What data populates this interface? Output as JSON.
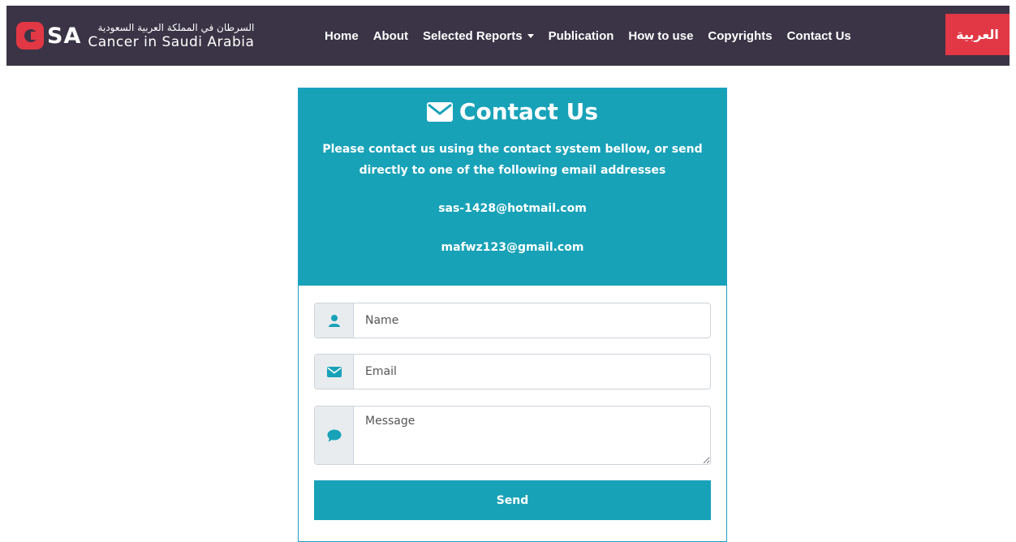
{
  "brand": {
    "logo_text": "SA",
    "arabic_tagline": "السرطان في المملكة العربية السعودية",
    "english_name": "Cancer in Saudi Arabia"
  },
  "nav": {
    "items": [
      {
        "label": "Home"
      },
      {
        "label": "About"
      },
      {
        "label": "Selected Reports",
        "dropdown": true
      },
      {
        "label": "Publication"
      },
      {
        "label": "How to use"
      },
      {
        "label": "Copyrights"
      },
      {
        "label": "Contact Us"
      }
    ],
    "language_button": "العربية"
  },
  "contact": {
    "title": "Contact Us",
    "description": "Please contact us using the contact system bellow, or send directly to one of the following email addresses",
    "emails": [
      "sas-1428@hotmail.com",
      "mafwz123@gmail.com"
    ]
  },
  "form": {
    "name_placeholder": "Name",
    "email_placeholder": "Email",
    "message_placeholder": "Message",
    "send_label": "Send"
  },
  "colors": {
    "navbar": "#3a3446",
    "accent_red": "#e23744",
    "teal": "#18a2b8"
  }
}
